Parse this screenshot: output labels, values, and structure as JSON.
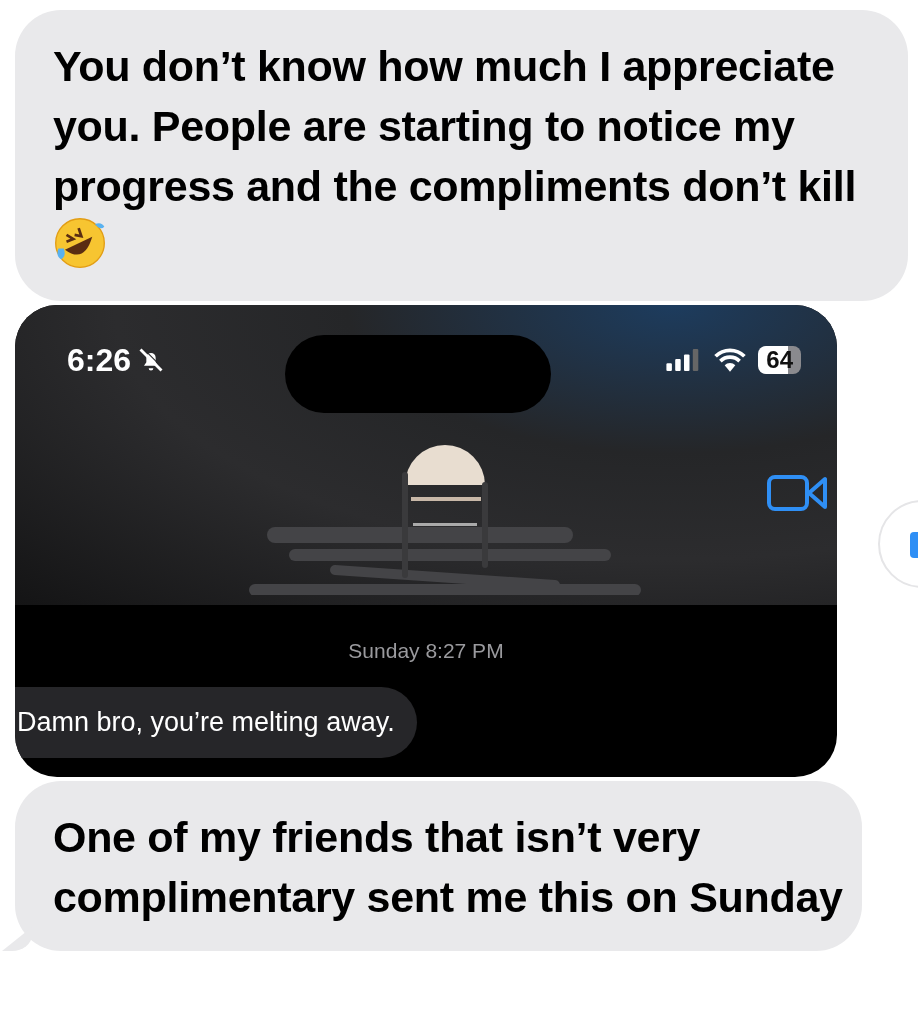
{
  "messages": [
    {
      "kind": "text",
      "text": "You don’t know how much I appreciate you. People are starting to notice my progress and the compliments don’t kill",
      "emoji": true,
      "tail": false
    },
    {
      "kind": "screenshot",
      "status_bar": {
        "time": "6:26",
        "battery": "64"
      },
      "timestamp": "Sunday 8:27 PM",
      "bubble": "Damn bro, you’re melting away."
    },
    {
      "kind": "text",
      "text": "One of my friends that isn’t very complimentary sent me this on Sunday",
      "emoji": false,
      "tail": true
    }
  ]
}
